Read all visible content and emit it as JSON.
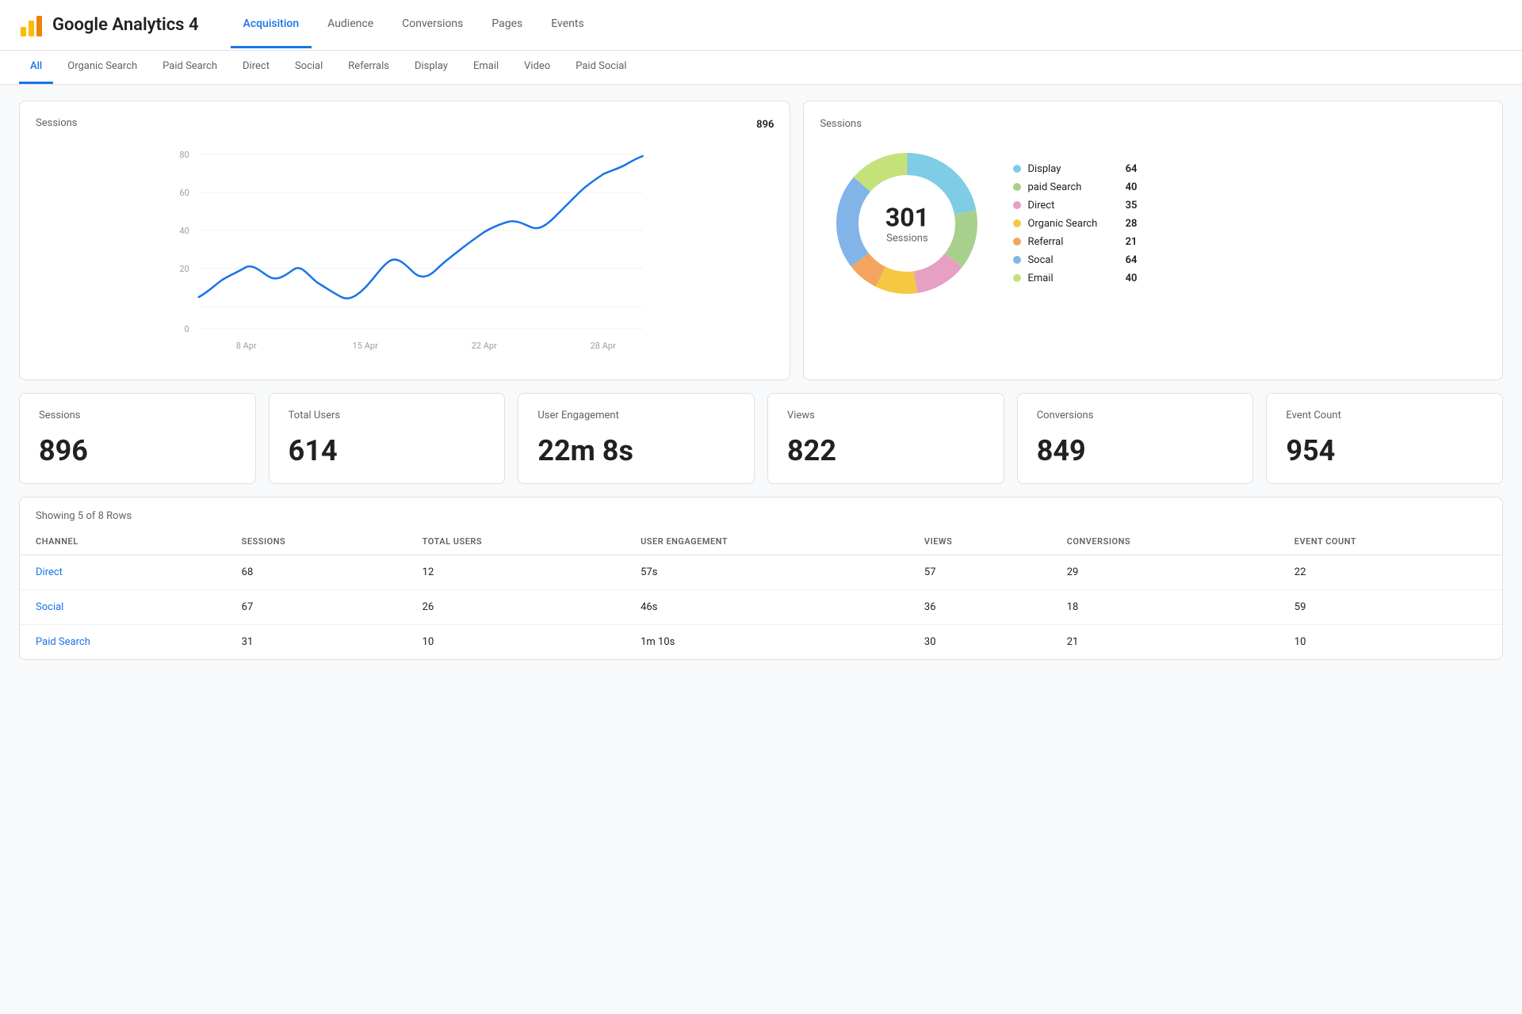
{
  "header": {
    "logo_text": "Google Analytics 4",
    "nav": [
      {
        "label": "Acquisition",
        "active": true
      },
      {
        "label": "Audience",
        "active": false
      },
      {
        "label": "Conversions",
        "active": false
      },
      {
        "label": "Pages",
        "active": false
      },
      {
        "label": "Events",
        "active": false
      }
    ],
    "sub_nav": [
      {
        "label": "All",
        "active": true
      },
      {
        "label": "Organic Search",
        "active": false
      },
      {
        "label": "Paid Search",
        "active": false
      },
      {
        "label": "Direct",
        "active": false
      },
      {
        "label": "Social",
        "active": false
      },
      {
        "label": "Referrals",
        "active": false
      },
      {
        "label": "Display",
        "active": false
      },
      {
        "label": "Email",
        "active": false
      },
      {
        "label": "Video",
        "active": false
      },
      {
        "label": "Paid Social",
        "active": false
      }
    ]
  },
  "line_chart": {
    "title": "Sessions",
    "value": "896",
    "x_labels": [
      "8 Apr",
      "15 Apr",
      "22 Apr",
      "28 Apr"
    ],
    "y_labels": [
      "80",
      "60",
      "40",
      "20",
      "0"
    ]
  },
  "donut_chart": {
    "title": "Sessions",
    "center_value": "301",
    "center_label": "Sessions",
    "legend": [
      {
        "name": "Display",
        "value": "64",
        "color": "#7ecce5"
      },
      {
        "name": "paid Search",
        "value": "40",
        "color": "#a8d08d"
      },
      {
        "name": "Direct",
        "value": "35",
        "color": "#e6a0c4"
      },
      {
        "name": "Organic Search",
        "value": "28",
        "color": "#f5c842"
      },
      {
        "name": "Referral",
        "value": "21",
        "color": "#f4a460"
      },
      {
        "name": "Socal",
        "value": "64",
        "color": "#82b4e8"
      },
      {
        "name": "Email",
        "value": "40",
        "color": "#c5e17a"
      }
    ]
  },
  "metrics": [
    {
      "label": "Sessions",
      "value": "896"
    },
    {
      "label": "Total Users",
      "value": "614"
    },
    {
      "label": "User Engagement",
      "value": "22m 8s"
    },
    {
      "label": "Views",
      "value": "822"
    },
    {
      "label": "Conversions",
      "value": "849"
    },
    {
      "label": "Event Count",
      "value": "954"
    }
  ],
  "table": {
    "showing_text": "Showing 5 of 8 Rows",
    "columns": [
      "CHANNEL",
      "SESSIONS",
      "TOTAL USERS",
      "USER ENGAGEMENT",
      "VIEWS",
      "CONVERSIONS",
      "EVENT COUNT"
    ],
    "rows": [
      {
        "channel": "Direct",
        "sessions": "68",
        "total_users": "12",
        "user_engagement": "57s",
        "views": "57",
        "conversions": "29",
        "event_count": "22"
      },
      {
        "channel": "Social",
        "sessions": "67",
        "total_users": "26",
        "user_engagement": "46s",
        "views": "36",
        "conversions": "18",
        "event_count": "59"
      },
      {
        "channel": "Paid Search",
        "sessions": "31",
        "total_users": "10",
        "user_engagement": "1m 10s",
        "views": "30",
        "conversions": "21",
        "event_count": "10"
      }
    ]
  }
}
